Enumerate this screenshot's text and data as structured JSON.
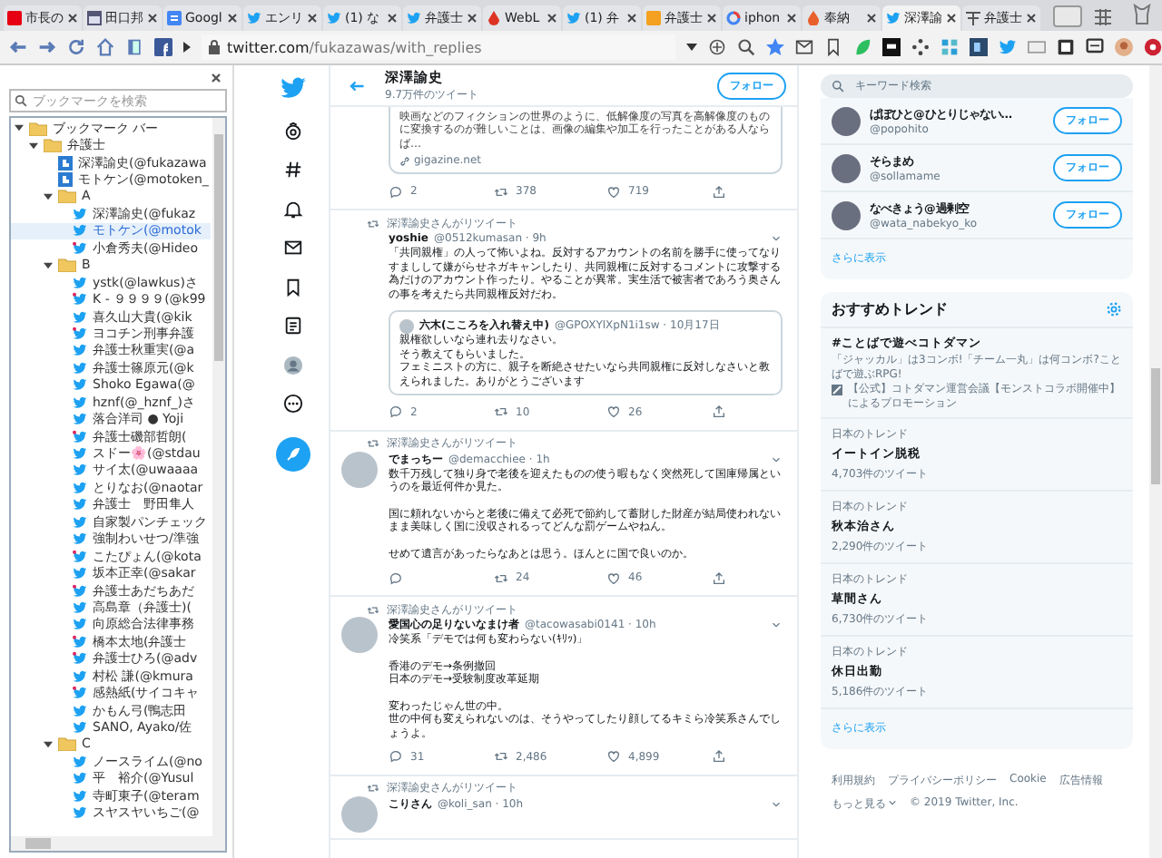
{
  "browser": {
    "tabs": [
      {
        "title": "市長の",
        "selected": false
      },
      {
        "title": "田口邦",
        "selected": false
      },
      {
        "title": "Googl",
        "selected": false
      },
      {
        "title": "エンリ",
        "selected": false
      },
      {
        "title": "(1) な",
        "selected": false
      },
      {
        "title": "弁護士",
        "selected": false
      },
      {
        "title": "WebL",
        "selected": false
      },
      {
        "title": "(1) 弁",
        "selected": false
      },
      {
        "title": "弁護士",
        "selected": false
      },
      {
        "title": "iphon",
        "selected": false
      },
      {
        "title": "奉納",
        "selected": false
      },
      {
        "title": "深澤諭",
        "selected": true
      },
      {
        "title": "弁護士",
        "selected": false
      }
    ],
    "address": {
      "host": "twitter.com",
      "path": "/fukazawas/with_replies"
    }
  },
  "bookmarks": {
    "search": {
      "placeholder": "ブックマークを検索"
    },
    "tree": [
      {
        "kind": "folder",
        "label": "ブックマーク バー",
        "expanded": true,
        "selected": false,
        "children": [
          {
            "kind": "folder",
            "label": "弁護士",
            "expanded": true,
            "selected": false,
            "children": [
              {
                "kind": "blog",
                "label": "深澤諭史(@fukazawa",
                "unread": false,
                "selected": false
              },
              {
                "kind": "blog",
                "label": "モトケン(@motoken_",
                "unread": false,
                "selected": false
              },
              {
                "kind": "folder",
                "label": "A",
                "expanded": true,
                "selected": false,
                "children": [
                  {
                    "kind": "twitter",
                    "label": "深澤諭史(@fukaz",
                    "unread": false,
                    "selected": false
                  },
                  {
                    "kind": "twitter",
                    "label": "モトケン(@motok",
                    "unread": false,
                    "selected": true
                  },
                  {
                    "kind": "twitter",
                    "label": "小倉秀夫(@Hideo",
                    "unread": true,
                    "selected": false
                  }
                ]
              },
              {
                "kind": "folder",
                "label": "B",
                "expanded": true,
                "selected": false,
                "children": [
                  {
                    "kind": "twitter",
                    "label": "ystk(@lawkus)さ",
                    "unread": false,
                    "selected": false
                  },
                  {
                    "kind": "twitter",
                    "label": "K - ９９９９(@k99",
                    "unread": true,
                    "selected": false
                  },
                  {
                    "kind": "twitter",
                    "label": "喜久山大貴(@kik",
                    "unread": false,
                    "selected": false
                  },
                  {
                    "kind": "twitter",
                    "label": "ヨコチン刑事弁護",
                    "unread": true,
                    "selected": false
                  },
                  {
                    "kind": "twitter",
                    "label": "弁護士秋重実(@a",
                    "unread": false,
                    "selected": false
                  },
                  {
                    "kind": "twitter",
                    "label": "弁護士篠原元(@k",
                    "unread": false,
                    "selected": false
                  },
                  {
                    "kind": "twitter",
                    "label": "Shoko Egawa(@",
                    "unread": false,
                    "selected": false
                  },
                  {
                    "kind": "twitter",
                    "label": "hznf(@_hznf_)さ",
                    "unread": false,
                    "selected": false
                  },
                  {
                    "kind": "twitter",
                    "label": "落合洋司 ● Yoji",
                    "unread": false,
                    "selected": false
                  },
                  {
                    "kind": "twitter",
                    "label": "弁護士磯部哲朗(",
                    "unread": true,
                    "selected": false
                  },
                  {
                    "kind": "twitter",
                    "label": "スドー🌸(@stdau",
                    "unread": false,
                    "selected": false
                  },
                  {
                    "kind": "twitter",
                    "label": "サイ太(@uwaaaa",
                    "unread": false,
                    "selected": false
                  },
                  {
                    "kind": "twitter",
                    "label": "とりなお(@naotar",
                    "unread": false,
                    "selected": false
                  },
                  {
                    "kind": "twitter",
                    "label": "弁護士　野田隼人",
                    "unread": false,
                    "selected": false
                  },
                  {
                    "kind": "twitter",
                    "label": "自家製パンチェック",
                    "unread": false,
                    "selected": false
                  },
                  {
                    "kind": "twitter",
                    "label": "強制わいせつ/準強",
                    "unread": false,
                    "selected": false
                  },
                  {
                    "kind": "twitter",
                    "label": "こたぴょん(@kota",
                    "unread": true,
                    "selected": false
                  },
                  {
                    "kind": "twitter",
                    "label": "坂本正幸(@sakar",
                    "unread": false,
                    "selected": false
                  },
                  {
                    "kind": "twitter",
                    "label": "弁護士あだちあだ",
                    "unread": true,
                    "selected": false
                  },
                  {
                    "kind": "twitter",
                    "label": "高島章（弁護士)(",
                    "unread": false,
                    "selected": false
                  },
                  {
                    "kind": "twitter",
                    "label": "向原総合法律事務",
                    "unread": false,
                    "selected": false
                  },
                  {
                    "kind": "twitter",
                    "label": "橋本太地(弁護士",
                    "unread": true,
                    "selected": false
                  },
                  {
                    "kind": "twitter",
                    "label": "弁護士ひろ(@adv",
                    "unread": true,
                    "selected": false
                  },
                  {
                    "kind": "twitter",
                    "label": "村松 謙(@kmura",
                    "unread": false,
                    "selected": false
                  },
                  {
                    "kind": "twitter",
                    "label": "感熱紙(サイコキャ",
                    "unread": true,
                    "selected": false
                  },
                  {
                    "kind": "twitter",
                    "label": "かもん弓(鴨志田",
                    "unread": false,
                    "selected": false
                  },
                  {
                    "kind": "twitter",
                    "label": "SANO, Ayako/佐",
                    "unread": false,
                    "selected": false
                  }
                ]
              },
              {
                "kind": "folder",
                "label": "C",
                "expanded": true,
                "selected": false,
                "children": [
                  {
                    "kind": "twitter",
                    "label": "ノースライム(@no",
                    "unread": false,
                    "selected": false
                  },
                  {
                    "kind": "twitter",
                    "label": "平　裕介(@Yusul",
                    "unread": false,
                    "selected": false
                  },
                  {
                    "kind": "twitter",
                    "label": "寺町東子(@teram",
                    "unread": false,
                    "selected": false
                  },
                  {
                    "kind": "twitter",
                    "label": "スヤスヤいちご(@",
                    "unread": false,
                    "selected": false
                  }
                ]
              }
            ]
          }
        ]
      }
    ]
  },
  "twitter": {
    "header": {
      "name": "深澤諭史",
      "count": "9.7万件のツイート",
      "follow": "フォロー"
    },
    "tweets": [
      {
        "kind": "cut",
        "card_text": "映画などのフィクションの世界のように、低解像度の写真を高解像度のものに変換するのが難しいことは、画像の編集や加工を行ったことがある人ならば…",
        "card_link": "gigazine.net",
        "replies": "2",
        "retweets": "378",
        "likes": "719"
      },
      {
        "kind": "full",
        "retweeted_by": "深澤諭史さんがリツイート",
        "has_avatar": false,
        "name": "yoshie",
        "handle": "@0512kumasan · 9h",
        "paragraphs": [
          [
            "「共同親権」の人って怖いよね。反対するアカウントの名前を勝手に使ってなりすましして嫌がらせネガキャンしたり、共同親権に反対するコメントに攻撃する為だけのアカウント作ったり。やることが異常。実生活で被害者であろう奥さんの事を考えたら共同親権反対だわ。"
          ]
        ],
        "quote": {
          "name": "六木(こころを入れ替え中)",
          "handle": "@GPOXYlXpN1i1sw · 10月17日",
          "paragraphs": [
            [
              "親権欲しいなら連れ去りなさい。",
              "そう教えてもらいました。",
              "フェミニストの方に、親子を断絶させたいなら共同親権に反対しなさいと教えられました。ありがとうございます"
            ]
          ]
        },
        "replies": "2",
        "retweets": "10",
        "likes": "26"
      },
      {
        "kind": "full",
        "retweeted_by": "深澤諭史さんがリツイート",
        "has_avatar": true,
        "name": "でまっちー",
        "handle": "@demacchiee · 1h",
        "paragraphs": [
          [
            "数千万残して独り身で老後を迎えたものの使う暇もなく突然死して国庫帰属というのを最近何件か見た。"
          ],
          [
            "国に頼れないからと老後に備えて必死で節約して蓄財した財産が結局使われないまま美味しく国に没収されるってどんな罰ゲームやねん。"
          ],
          [
            "せめて遺言があったらなあとは思う。ほんとに国で良いのか。"
          ]
        ],
        "retweets": "24",
        "likes": "46"
      },
      {
        "kind": "full",
        "retweeted_by": "深澤諭史さんがリツイート",
        "has_avatar": true,
        "name": "愛国心の足りないなまけ者",
        "handle": "@tacowasabi0141 · 10h",
        "paragraphs": [
          [
            "冷笑系「デモでは何も変わらない(ｷﾘｯ)」"
          ],
          [
            "香港のデモ→条例撤回",
            "日本のデモ→受験制度改革延期"
          ],
          [
            "変わったじゃん世の中。",
            "世の中何も変えられないのは、そうやってしたり顔してるキミら冷笑系さんでしょうよ。"
          ]
        ],
        "replies": "31",
        "retweets": "2,486",
        "likes": "4,899"
      },
      {
        "kind": "partial",
        "retweeted_by": "深澤諭史さんがリツイート",
        "has_avatar": true,
        "name": "こりさん",
        "handle": "@koli_san · 10h"
      }
    ],
    "side": {
      "search": {
        "placeholder": "キーワード検索"
      },
      "users": [
        {
          "name": "ぱぽひと@ひとりじゃない…",
          "handle": "@popohito",
          "button": "フォロー"
        },
        {
          "name": "そらまめ",
          "handle": "@sollamame",
          "button": "フォロー"
        },
        {
          "name": "なべきょう@過剰空",
          "handle": "@wata_nabekyo_ko",
          "button": "フォロー"
        }
      ],
      "users_more": "さらに表示",
      "trends": {
        "title": "おすすめトレンド",
        "promoted": {
          "name": "#ことばで遊べコトダマン",
          "description": "「ジャッカル」は3コンボ!「チーム一丸」は何コンボ?ことばで遊ぶRPG!",
          "promoter": "【公式】コトダマン運営会議【モンストコラボ開催中】によるプロモーション"
        },
        "items": [
          {
            "context": "日本のトレンド",
            "name": "イートイン脱税",
            "count": "4,703件のツイート"
          },
          {
            "context": "日本のトレンド",
            "name": "秋本治さん",
            "count": "2,290件のツイート"
          },
          {
            "context": "日本のトレンド",
            "name": "草間さん",
            "count": "6,730件のツイート"
          },
          {
            "context": "日本のトレンド",
            "name": "休日出勤",
            "count": "5,186件のツイート"
          }
        ],
        "more": "さらに表示"
      },
      "footer": {
        "links": [
          "利用規約",
          "プライバシーポリシー",
          "Cookie",
          "広告情報"
        ],
        "more": "もっと見る",
        "copyright": "© 2019 Twitter, Inc."
      }
    }
  }
}
